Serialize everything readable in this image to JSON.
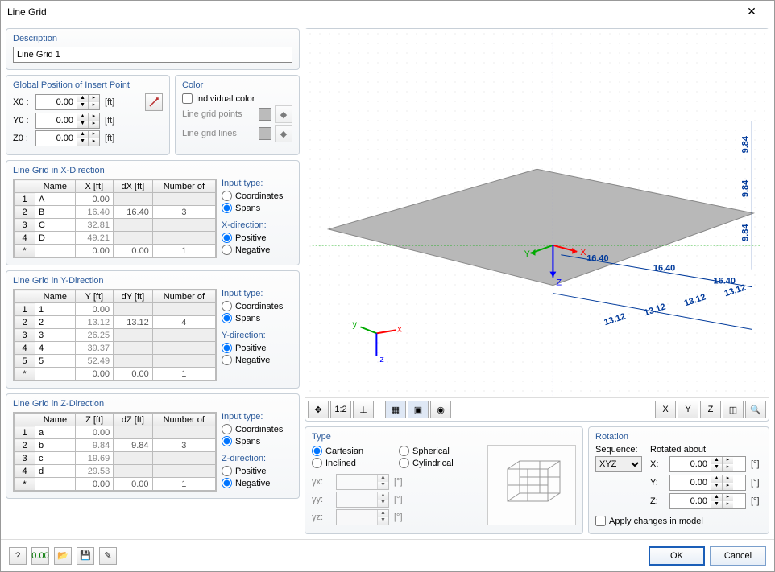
{
  "window": {
    "title": "Line Grid"
  },
  "description": {
    "title": "Description",
    "value": "Line Grid 1"
  },
  "globalpos": {
    "title": "Global Position of Insert Point",
    "x": {
      "label": "X0 :",
      "value": "0.00",
      "unit": "[ft]"
    },
    "y": {
      "label": "Y0 :",
      "value": "0.00",
      "unit": "[ft]"
    },
    "z": {
      "label": "Z0 :",
      "value": "0.00",
      "unit": "[ft]"
    }
  },
  "color": {
    "title": "Color",
    "individual": "Individual color",
    "points": "Line grid points",
    "lines": "Line grid lines"
  },
  "grid_x": {
    "title": "Line Grid in X-Direction",
    "cols": {
      "name": "Name",
      "coord": "X [ft]",
      "delta": "dX [ft]",
      "num": "Number of"
    },
    "rows": [
      {
        "n": "1",
        "name": "A",
        "coord": "0.00",
        "d": "",
        "num": ""
      },
      {
        "n": "2",
        "name": "B",
        "coord": "16.40",
        "d": "16.40",
        "num": "3"
      },
      {
        "n": "3",
        "name": "C",
        "coord": "32.81",
        "d": "",
        "num": ""
      },
      {
        "n": "4",
        "name": "D",
        "coord": "49.21",
        "d": "",
        "num": ""
      },
      {
        "n": "*",
        "name": "",
        "coord": "0.00",
        "d": "0.00",
        "num": "1"
      }
    ],
    "input_title": "Input type:",
    "opt1": "Coordinates",
    "opt2": "Spans",
    "dir_title": "X-direction:",
    "optp": "Positive",
    "optn": "Negative"
  },
  "grid_y": {
    "title": "Line Grid in Y-Direction",
    "cols": {
      "name": "Name",
      "coord": "Y [ft]",
      "delta": "dY [ft]",
      "num": "Number of"
    },
    "rows": [
      {
        "n": "1",
        "name": "1",
        "coord": "0.00",
        "d": "",
        "num": ""
      },
      {
        "n": "2",
        "name": "2",
        "coord": "13.12",
        "d": "13.12",
        "num": "4"
      },
      {
        "n": "3",
        "name": "3",
        "coord": "26.25",
        "d": "",
        "num": ""
      },
      {
        "n": "4",
        "name": "4",
        "coord": "39.37",
        "d": "",
        "num": ""
      },
      {
        "n": "5",
        "name": "5",
        "coord": "52.49",
        "d": "",
        "num": ""
      },
      {
        "n": "*",
        "name": "",
        "coord": "0.00",
        "d": "0.00",
        "num": "1"
      }
    ],
    "input_title": "Input type:",
    "opt1": "Coordinates",
    "opt2": "Spans",
    "dir_title": "Y-direction:",
    "optp": "Positive",
    "optn": "Negative"
  },
  "grid_z": {
    "title": "Line Grid in Z-Direction",
    "cols": {
      "name": "Name",
      "coord": "Z [ft]",
      "delta": "dZ [ft]",
      "num": "Number of"
    },
    "rows": [
      {
        "n": "1",
        "name": "a",
        "coord": "0.00",
        "d": "",
        "num": ""
      },
      {
        "n": "2",
        "name": "b",
        "coord": "9.84",
        "d": "9.84",
        "num": "3"
      },
      {
        "n": "3",
        "name": "c",
        "coord": "19.69",
        "d": "",
        "num": ""
      },
      {
        "n": "4",
        "name": "d",
        "coord": "29.53",
        "d": "",
        "num": ""
      },
      {
        "n": "*",
        "name": "",
        "coord": "0.00",
        "d": "0.00",
        "num": "1"
      }
    ],
    "input_title": "Input type:",
    "opt1": "Coordinates",
    "opt2": "Spans",
    "dir_title": "Z-direction:",
    "optp": "Positive",
    "optn": "Negative"
  },
  "type": {
    "title": "Type",
    "cartesian": "Cartesian",
    "inclined": "Inclined",
    "spherical": "Spherical",
    "cylindrical": "Cylindrical",
    "gx": "γx:",
    "gy": "γy:",
    "gz": "γz:",
    "unit": "[°]"
  },
  "rotation": {
    "title": "Rotation",
    "sequence": "Sequence:",
    "about": "Rotated about",
    "seqval": "XYZ",
    "x": "X:",
    "y": "Y:",
    "z": "Z:",
    "val": "0.00",
    "unit": "[°]",
    "apply": "Apply changes in model"
  },
  "preview": {
    "dims": {
      "x1": "16.40",
      "x2": "16.40",
      "x3": "16.40",
      "y1": "13.12",
      "y2": "13.12",
      "y3": "13.12",
      "y4": "13.12",
      "z1": "9.84",
      "z2": "9.84",
      "z3": "9.84"
    }
  },
  "footer": {
    "ok": "OK",
    "cancel": "Cancel"
  }
}
